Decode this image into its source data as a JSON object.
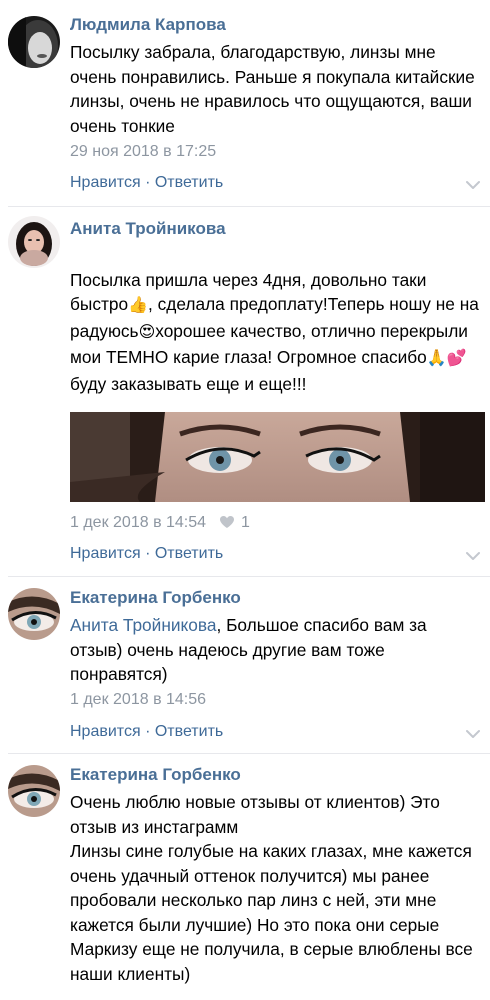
{
  "comments": [
    {
      "author": "Людмила Карпова",
      "text": "Посылку забрала, благодарствую, линзы мне очень понравились. Раньше я покупала китайские линзы, очень не нравилось что ощущаются, ваши очень тонкие",
      "date": "29 ноя 2018 в 17:25",
      "like_label": "Нравится",
      "separator": "·",
      "reply_label": "Ответить"
    },
    {
      "author": "Анита Тройникова",
      "text_parts": [
        "Посылка пришла через 4дня, довольно таки быстро",
        "👍",
        ", сделала предоплату!Теперь ношу не на радуюсь",
        "😍",
        "хорошее качество, отлично перекрыли мои ТЕМНО карие глаза! Огромное спасибо",
        "🙏💕",
        "буду заказывать еще и еще!!!"
      ],
      "date": "1 дек 2018 в 14:54",
      "likes": "1",
      "like_label": "Нравится",
      "separator": "·",
      "reply_label": "Ответить"
    },
    {
      "author": "Екатерина Горбенко",
      "reply_to": "Анита Тройникова",
      "text": ", Большое спасибо вам за отзыв) очень надеюсь другие вам тоже понравятся)",
      "date": "1 дек 2018 в 14:56",
      "like_label": "Нравится",
      "separator": "·",
      "reply_label": "Ответить"
    },
    {
      "author": "Екатерина Горбенко",
      "text": "Очень люблю новые отзывы от клиентов) Это отзыв из инстаграмм\nЛинзы сине голубые на каких глазах, мне кажется очень удачный оттенок получится) мы ранее пробовали несколько пар линз с ней, эти мне кажется были лучшие) Но это пока они серые Маркизу еще не получила, в серые влюблены все наши клиенты)"
    }
  ],
  "colors": {
    "author": "#4a6f96",
    "link": "#3f6a98",
    "meta": "#8d96a1",
    "divider": "#e7e8ec"
  }
}
